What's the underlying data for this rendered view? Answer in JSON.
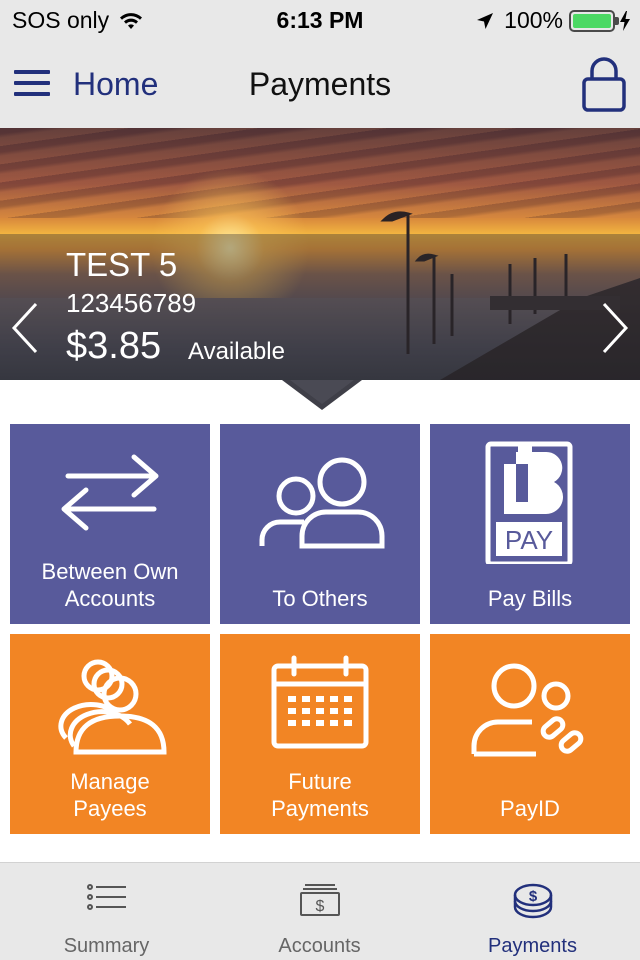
{
  "status_bar": {
    "carrier": "SOS only",
    "time": "6:13 PM",
    "battery": "100%",
    "battery_level": 1.0
  },
  "nav": {
    "home_label": "Home",
    "title": "Payments"
  },
  "account": {
    "name": "TEST 5",
    "number": "123456789",
    "balance": "$3.85",
    "available_label": "Available"
  },
  "tiles": [
    {
      "label_line1": "Between Own",
      "label_line2": "Accounts",
      "icon": "transfer-arrows-icon",
      "color": "#585a9b"
    },
    {
      "label_line1": "",
      "label_line2": "To Others",
      "icon": "people-icon",
      "color": "#585a9b"
    },
    {
      "label_line1": "",
      "label_line2": "Pay Bills",
      "icon": "bpay-icon",
      "color": "#585a9b"
    },
    {
      "label_line1": "Manage",
      "label_line2": "Payees",
      "icon": "payees-group-icon",
      "color": "#f28524"
    },
    {
      "label_line1": "Future",
      "label_line2": "Payments",
      "icon": "calendar-icon",
      "color": "#f28524"
    },
    {
      "label_line1": "",
      "label_line2": "PayID",
      "icon": "payid-link-icon",
      "color": "#f28524"
    }
  ],
  "bpay_text": "PAY",
  "tabs": [
    {
      "label": "Summary",
      "icon": "list-icon",
      "active": false
    },
    {
      "label": "Accounts",
      "icon": "dollar-stack-icon",
      "active": false
    },
    {
      "label": "Payments",
      "icon": "coins-icon",
      "active": true
    }
  ],
  "colors": {
    "brand_navy": "#22307c",
    "tile_purple": "#585a9b",
    "tile_orange": "#f28524",
    "battery_green": "#4cd964"
  }
}
